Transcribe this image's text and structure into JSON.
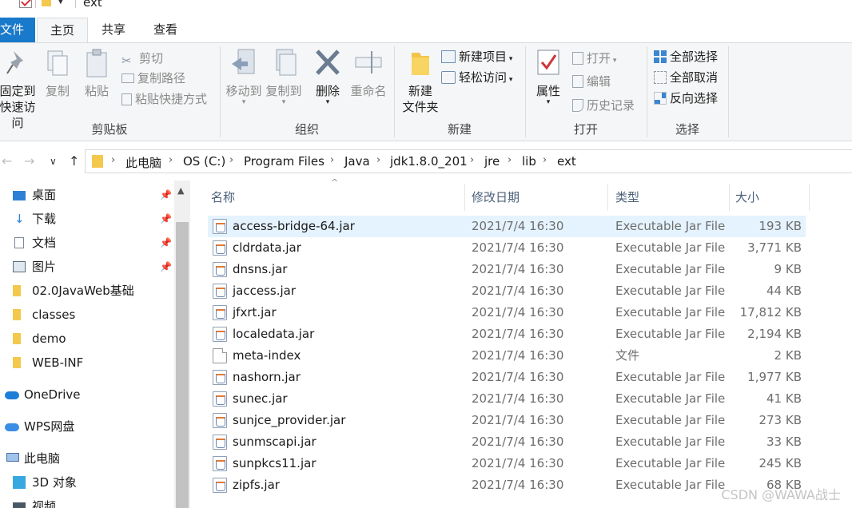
{
  "window": {
    "title": "ext"
  },
  "ribbon_tabs": {
    "file": "文件",
    "home": "主页",
    "share": "共享",
    "view": "查看"
  },
  "ribbon": {
    "clipboard": {
      "pin_line1": "固定到",
      "pin_line2": "快速访问",
      "copy": "复制",
      "paste": "粘贴",
      "cut": "剪切",
      "copy_path": "复制路径",
      "paste_shortcut": "粘贴快捷方式",
      "label": "剪贴板"
    },
    "organize": {
      "move_to": "移动到",
      "copy_to": "复制到",
      "delete": "删除",
      "rename": "重命名",
      "label": "组织"
    },
    "new": {
      "new_item": "新建项目",
      "easy_access": "轻松访问",
      "new_folder_line1": "新建",
      "new_folder_line2": "文件夹",
      "label": "新建"
    },
    "open": {
      "properties": "属性",
      "open": "打开",
      "edit": "编辑",
      "history": "历史记录",
      "label": "打开"
    },
    "select": {
      "select_all": "全部选择",
      "select_none": "全部取消",
      "invert": "反向选择",
      "label": "选择"
    }
  },
  "breadcrumb": [
    "此电脑",
    "OS (C:)",
    "Program Files",
    "Java",
    "jdk1.8.0_201",
    "jre",
    "lib",
    "ext"
  ],
  "nav": {
    "quick": [
      {
        "label": "桌面",
        "pinned": true
      },
      {
        "label": "下载",
        "pinned": true
      },
      {
        "label": "文档",
        "pinned": true
      },
      {
        "label": "图片",
        "pinned": true
      },
      {
        "label": "02.0JavaWeb基础",
        "pinned": false
      },
      {
        "label": "classes",
        "pinned": false
      },
      {
        "label": "demo",
        "pinned": false
      },
      {
        "label": "WEB-INF",
        "pinned": false
      }
    ],
    "onedrive": "OneDrive",
    "wps": "WPS网盘",
    "thispc": "此电脑",
    "objects3d": "3D 对象",
    "video": "视频"
  },
  "columns": {
    "name": "名称",
    "date": "修改日期",
    "type": "类型",
    "size": "大小"
  },
  "files": [
    {
      "name": "access-bridge-64.jar",
      "date": "2021/7/4 16:30",
      "type": "Executable Jar File",
      "size": "193 KB",
      "icon": "jar",
      "selected": true
    },
    {
      "name": "cldrdata.jar",
      "date": "2021/7/4 16:30",
      "type": "Executable Jar File",
      "size": "3,771 KB",
      "icon": "jar"
    },
    {
      "name": "dnsns.jar",
      "date": "2021/7/4 16:30",
      "type": "Executable Jar File",
      "size": "9 KB",
      "icon": "jar"
    },
    {
      "name": "jaccess.jar",
      "date": "2021/7/4 16:30",
      "type": "Executable Jar File",
      "size": "44 KB",
      "icon": "jar"
    },
    {
      "name": "jfxrt.jar",
      "date": "2021/7/4 16:30",
      "type": "Executable Jar File",
      "size": "17,812 KB",
      "icon": "jar"
    },
    {
      "name": "localedata.jar",
      "date": "2021/7/4 16:30",
      "type": "Executable Jar File",
      "size": "2,194 KB",
      "icon": "jar"
    },
    {
      "name": "meta-index",
      "date": "2021/7/4 16:30",
      "type": "文件",
      "size": "2 KB",
      "icon": "doc"
    },
    {
      "name": "nashorn.jar",
      "date": "2021/7/4 16:30",
      "type": "Executable Jar File",
      "size": "1,977 KB",
      "icon": "jar"
    },
    {
      "name": "sunec.jar",
      "date": "2021/7/4 16:30",
      "type": "Executable Jar File",
      "size": "41 KB",
      "icon": "jar"
    },
    {
      "name": "sunjce_provider.jar",
      "date": "2021/7/4 16:30",
      "type": "Executable Jar File",
      "size": "273 KB",
      "icon": "jar"
    },
    {
      "name": "sunmscapi.jar",
      "date": "2021/7/4 16:30",
      "type": "Executable Jar File",
      "size": "33 KB",
      "icon": "jar"
    },
    {
      "name": "sunpkcs11.jar",
      "date": "2021/7/4 16:30",
      "type": "Executable Jar File",
      "size": "245 KB",
      "icon": "jar"
    },
    {
      "name": "zipfs.jar",
      "date": "2021/7/4 16:30",
      "type": "Executable Jar File",
      "size": "68 KB",
      "icon": "jar"
    }
  ],
  "watermark": "CSDN @WAWA战士"
}
